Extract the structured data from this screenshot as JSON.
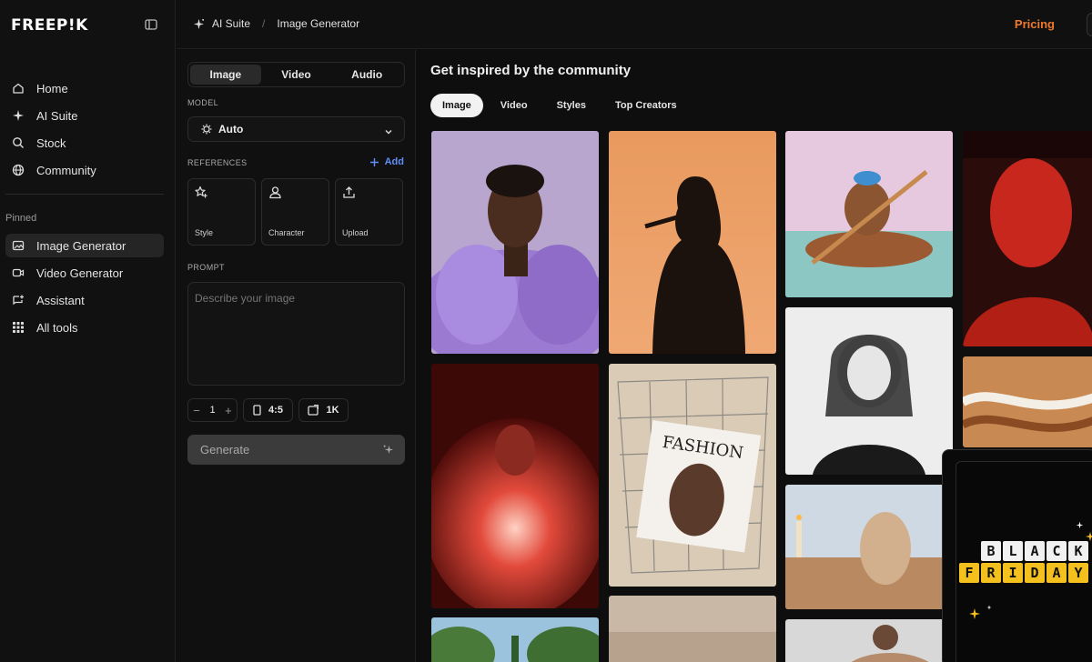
{
  "brand": {
    "logo": "FREEP!K"
  },
  "sidebar": {
    "items": [
      {
        "label": "Home",
        "icon": "home-icon"
      },
      {
        "label": "AI Suite",
        "icon": "sparkle-icon"
      },
      {
        "label": "Stock",
        "icon": "search-icon"
      },
      {
        "label": "Community",
        "icon": "globe-icon"
      }
    ],
    "pinned_label": "Pinned",
    "pinned": [
      {
        "label": "Image Generator",
        "icon": "image-icon",
        "active": true
      },
      {
        "label": "Video Generator",
        "icon": "video-icon"
      },
      {
        "label": "Assistant",
        "icon": "chat-plus-icon"
      },
      {
        "label": "All tools",
        "icon": "grid-icon"
      }
    ]
  },
  "topbar": {
    "breadcrumb": [
      "AI Suite",
      "Image Generator"
    ],
    "pricing": "Pricing",
    "pricing_color": "#ef7a2e"
  },
  "panel": {
    "tabs": [
      "Image",
      "Video",
      "Audio"
    ],
    "active_tab": "Image",
    "model_label": "MODEL",
    "model_value": "Auto",
    "references_label": "REFERENCES",
    "add_label": "Add",
    "references": [
      {
        "label": "Style",
        "icon": "style-icon"
      },
      {
        "label": "Character",
        "icon": "person-icon"
      },
      {
        "label": "Upload",
        "icon": "upload-icon"
      }
    ],
    "prompt_label": "PROMPT",
    "prompt_placeholder": "Describe your image",
    "count": "1",
    "aspect_ratio": "4:5",
    "resolution": "1K",
    "generate_label": "Generate",
    "accent_color": "#5e8ef7"
  },
  "community": {
    "title": "Get inspired by the community",
    "tabs": [
      "Image",
      "Video",
      "Styles",
      "Top Creators"
    ],
    "active_tab": "Image",
    "promo": {
      "line1": [
        "B",
        "L",
        "A",
        "C",
        "K"
      ],
      "line2": [
        "F",
        "R",
        "I",
        "D",
        "A",
        "Y"
      ]
    }
  }
}
